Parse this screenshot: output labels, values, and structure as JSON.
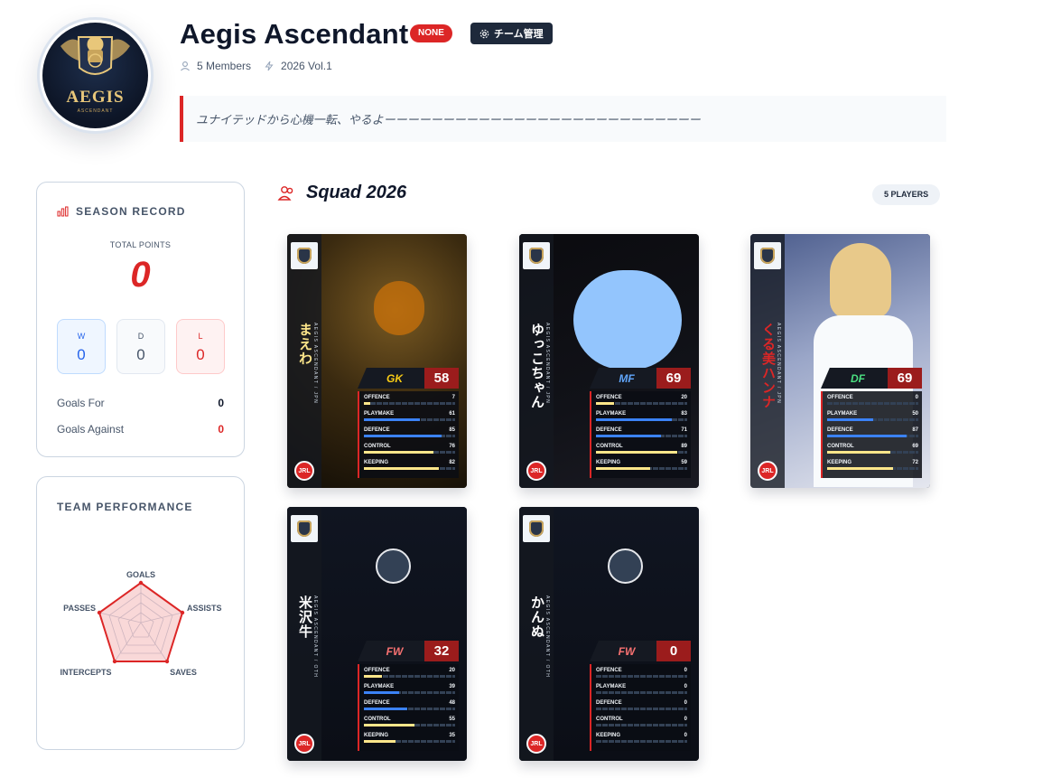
{
  "team": {
    "name": "Aegis Ascendant",
    "badge": "NONE",
    "manage_label": "チーム管理",
    "members": "5 Members",
    "season": "2026 Vol.1",
    "motto": "ユナイテッドから心機一転、やるよーーーーーーーーーーーーーーーーーーーーーーーーーーー",
    "logo_text": "AEGIS",
    "logo_sub": "ASCENDANT"
  },
  "season_record": {
    "title": "SEASON RECORD",
    "total_points_label": "TOTAL POINTS",
    "total_points": "0",
    "w_label": "W",
    "w": "0",
    "d_label": "D",
    "d": "0",
    "l_label": "L",
    "l": "0",
    "goals_for_label": "Goals For",
    "goals_for": "0",
    "goals_against_label": "Goals Against",
    "goals_against": "0"
  },
  "team_performance": {
    "title": "TEAM PERFORMANCE",
    "axes": [
      "GOALS",
      "ASSISTS",
      "SAVES",
      "INTERCEPTS",
      "PASSES"
    ]
  },
  "squad": {
    "title": "Squad 2026",
    "count_label": "5 PLAYERS",
    "stat_labels": [
      "OFFENCE",
      "PLAYMAKE",
      "DEFENCE",
      "CONTROL",
      "KEEPING"
    ],
    "brand": "JRL",
    "players": [
      {
        "name": "まえわ",
        "team_line": "AEGIS ASCENDANT / JPN",
        "position": "GK",
        "rating": "58",
        "pos_color": "#facc15",
        "stats": [
          "7",
          "61",
          "85",
          "76",
          "82"
        ],
        "levels": [
          0.07,
          0.61,
          0.85,
          0.76,
          0.82
        ]
      },
      {
        "name": "ゆっこちゃん",
        "team_line": "AEGIS ASCENDANT / JPN",
        "position": "MF",
        "rating": "69",
        "pos_color": "#60a5fa",
        "stats": [
          "20",
          "83",
          "71",
          "89",
          "59"
        ],
        "levels": [
          0.2,
          0.83,
          0.71,
          0.89,
          0.59
        ]
      },
      {
        "name": "くる美ハンナ",
        "team_line": "AEGIS ASCENDANT / JPN",
        "position": "DF",
        "rating": "69",
        "pos_color": "#4ade80",
        "stats": [
          "0",
          "50",
          "87",
          "69",
          "72"
        ],
        "levels": [
          0.0,
          0.5,
          0.87,
          0.69,
          0.72
        ]
      },
      {
        "name": "米沢牛",
        "team_line": "AEGIS ASCENDANT / OTH",
        "position": "FW",
        "rating": "32",
        "pos_color": "#f87171",
        "stats": [
          "20",
          "39",
          "48",
          "55",
          "35"
        ],
        "levels": [
          0.2,
          0.39,
          0.48,
          0.55,
          0.35
        ]
      },
      {
        "name": "かんぬ",
        "team_line": "AEGIS ASCENDANT / OTH",
        "position": "FW",
        "rating": "0",
        "pos_color": "#f87171",
        "stats": [
          "0",
          "0",
          "0",
          "0",
          "0"
        ],
        "levels": [
          0,
          0,
          0,
          0,
          0
        ]
      }
    ]
  },
  "colors": {
    "accent": "#dc2626",
    "dark": "#1e293b",
    "bar_blue": "#3b82f6",
    "bar_yellow": "#fde68a"
  }
}
